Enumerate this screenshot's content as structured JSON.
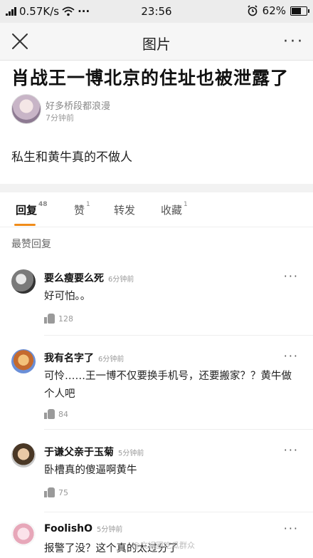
{
  "status_bar": {
    "network_speed": "0.57K/s",
    "dots": "···",
    "time": "23:56",
    "battery": "62%"
  },
  "nav": {
    "title": "图片",
    "more": "···"
  },
  "post": {
    "headline": "肖战王一博北京的住址也被泄露了",
    "author": "好多桥段都浪漫",
    "time": "7分钟前",
    "body": "私生和黄牛真的不做人"
  },
  "tabs": [
    {
      "label": "回复",
      "count": "48"
    },
    {
      "label": "赞",
      "count": "1"
    },
    {
      "label": "转发",
      "count": ""
    },
    {
      "label": "收藏",
      "count": "1"
    }
  ],
  "section_label": "最赞回复",
  "comments": [
    {
      "name": "要么瘦要么死",
      "time": "6分钟前",
      "text": "好可怕。。",
      "likes": "128"
    },
    {
      "name": "我有名字了",
      "time": "6分钟前",
      "text": "可怜……王一博不仅要换手机号，还要搬家？？黄牛做个人吧",
      "likes": "84"
    },
    {
      "name": "于谦父亲于玉菊",
      "time": "5分钟前",
      "text": "卧槽真的傻逼啊黄牛",
      "likes": "75"
    },
    {
      "name": "FoolishO",
      "time": "5分钟前",
      "text": "报警了没？这个真的太过分了",
      "likes": ""
    }
  ],
  "comment_more": "···",
  "watermark": "@文娱圈吃瓜群众"
}
